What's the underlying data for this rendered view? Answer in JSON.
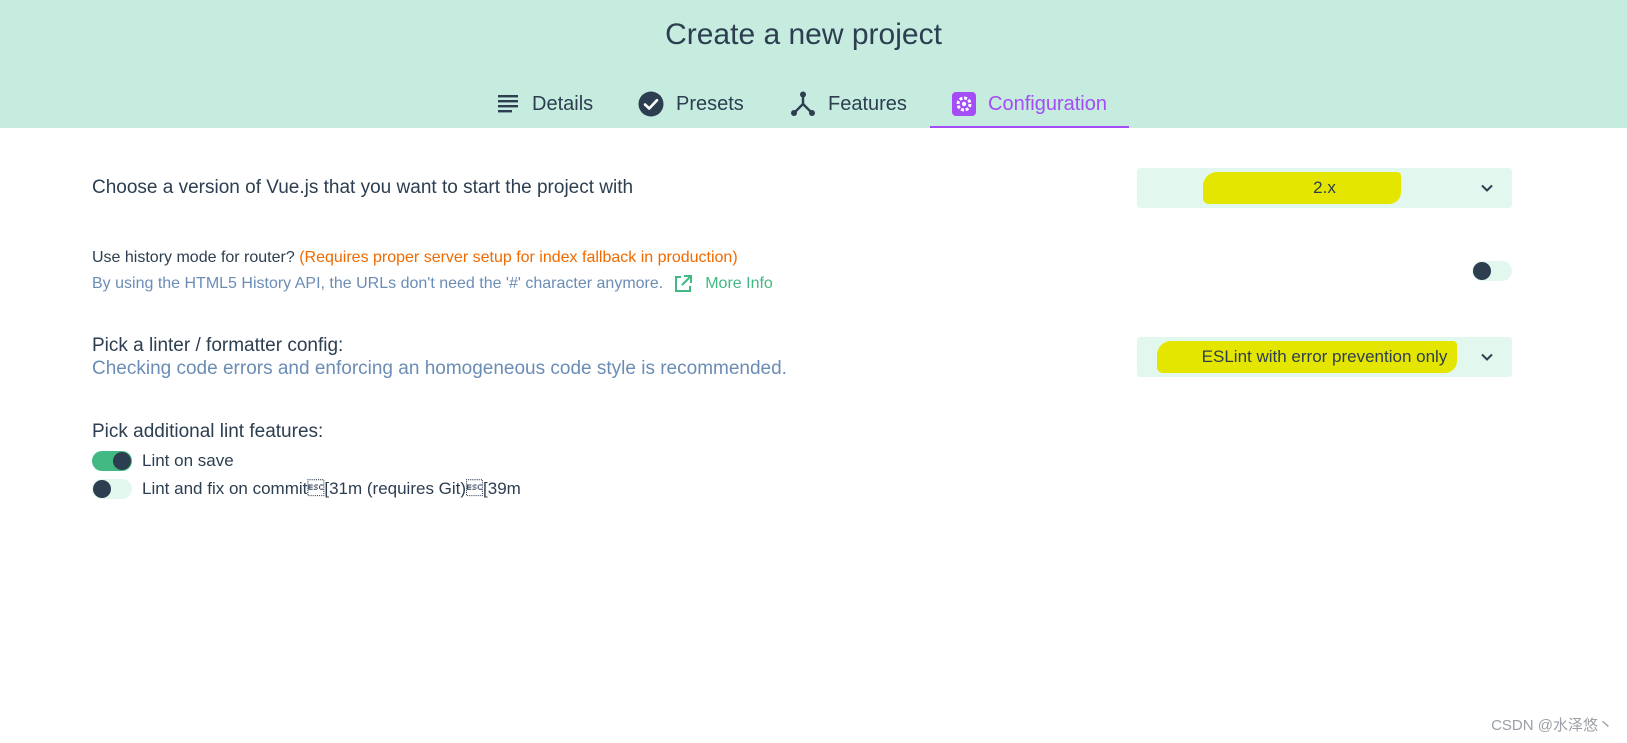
{
  "header": {
    "title": "Create a new project",
    "tabs": [
      {
        "label": "Details",
        "icon": "list-icon"
      },
      {
        "label": "Presets",
        "icon": "check-circle-icon"
      },
      {
        "label": "Features",
        "icon": "fork-icon"
      },
      {
        "label": "Configuration",
        "icon": "gear-icon",
        "active": true
      }
    ]
  },
  "vue_version": {
    "label": "Choose a version of Vue.js that you want to start the project with",
    "selected": "2.x"
  },
  "history_mode": {
    "label": "Use history mode for router?",
    "warning": "(Requires proper server setup for index fallback in production)",
    "description": "By using the HTML5 History API, the URLs don't need the '#' character anymore.",
    "link_label": "More Info",
    "enabled": false
  },
  "linter": {
    "label": "Pick a linter / formatter config:",
    "description": "Checking code errors and enforcing an homogeneous code style is recommended.",
    "selected": "ESLint with error prevention only"
  },
  "lint_features": {
    "label": "Pick additional lint features:",
    "items": [
      {
        "label": "Lint on save",
        "enabled": true
      },
      {
        "label": "Lint and fix on commit\u001b[31m (requires Git)\u001b[39m",
        "enabled": false
      }
    ]
  },
  "watermark": "CSDN @水泽悠丶",
  "colors": {
    "header_bg": "#c6ebdf",
    "accent": "#a44cf6",
    "primary_text": "#2c3e50",
    "warning": "#f06a00",
    "link": "#42b983",
    "highlight": "#e5e600"
  }
}
